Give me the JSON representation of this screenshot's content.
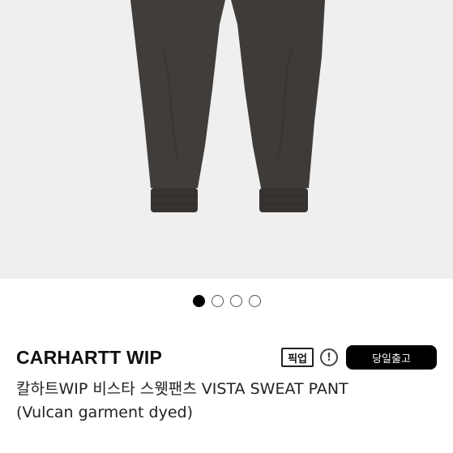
{
  "gallery": {
    "dots": [
      {
        "active": true
      },
      {
        "active": false
      },
      {
        "active": false
      },
      {
        "active": false
      }
    ]
  },
  "product": {
    "brand": "CARHARTT WIP",
    "pickup_label": "픽업",
    "info_icon": "!",
    "sameday_label": "당일출고",
    "title_line1": "칼하트WIP 비스타 스웻팬츠 VISTA SWEAT PANT",
    "title_line2": "(Vulcan garment dyed)"
  },
  "colors": {
    "image_bg": "#efefef",
    "pants": "#3f3c3a",
    "badge_bg": "#000000"
  }
}
